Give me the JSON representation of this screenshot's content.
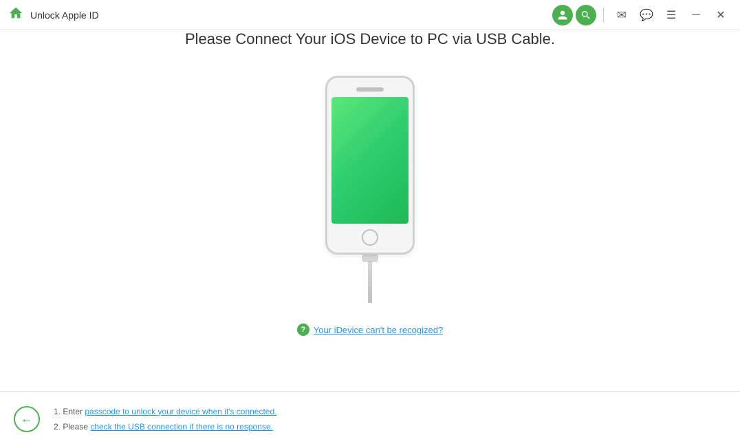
{
  "titlebar": {
    "app_title": "Unlock Apple ID",
    "home_icon": "home-icon",
    "avatar_icon": "user-avatar-icon",
    "search_icon": "search-avatar-icon",
    "mail_icon": "mail-icon",
    "chat_icon": "chat-icon",
    "menu_icon": "menu-icon",
    "minimize_icon": "minimize-icon",
    "close_icon": "close-icon"
  },
  "main": {
    "connect_title": "Please Connect Your iOS Device to PC via USB Cable.",
    "help_link": "Your iDevice can't be recogized?"
  },
  "bottom": {
    "hint1": "1. Enter passcode to unlock your device when it's connected.",
    "hint1_link": "passcode to unlock your device when it's connected.",
    "hint2": "2. Please check the USB connection if there is no response.",
    "hint2_link": "check the USB connection if there is no response."
  }
}
